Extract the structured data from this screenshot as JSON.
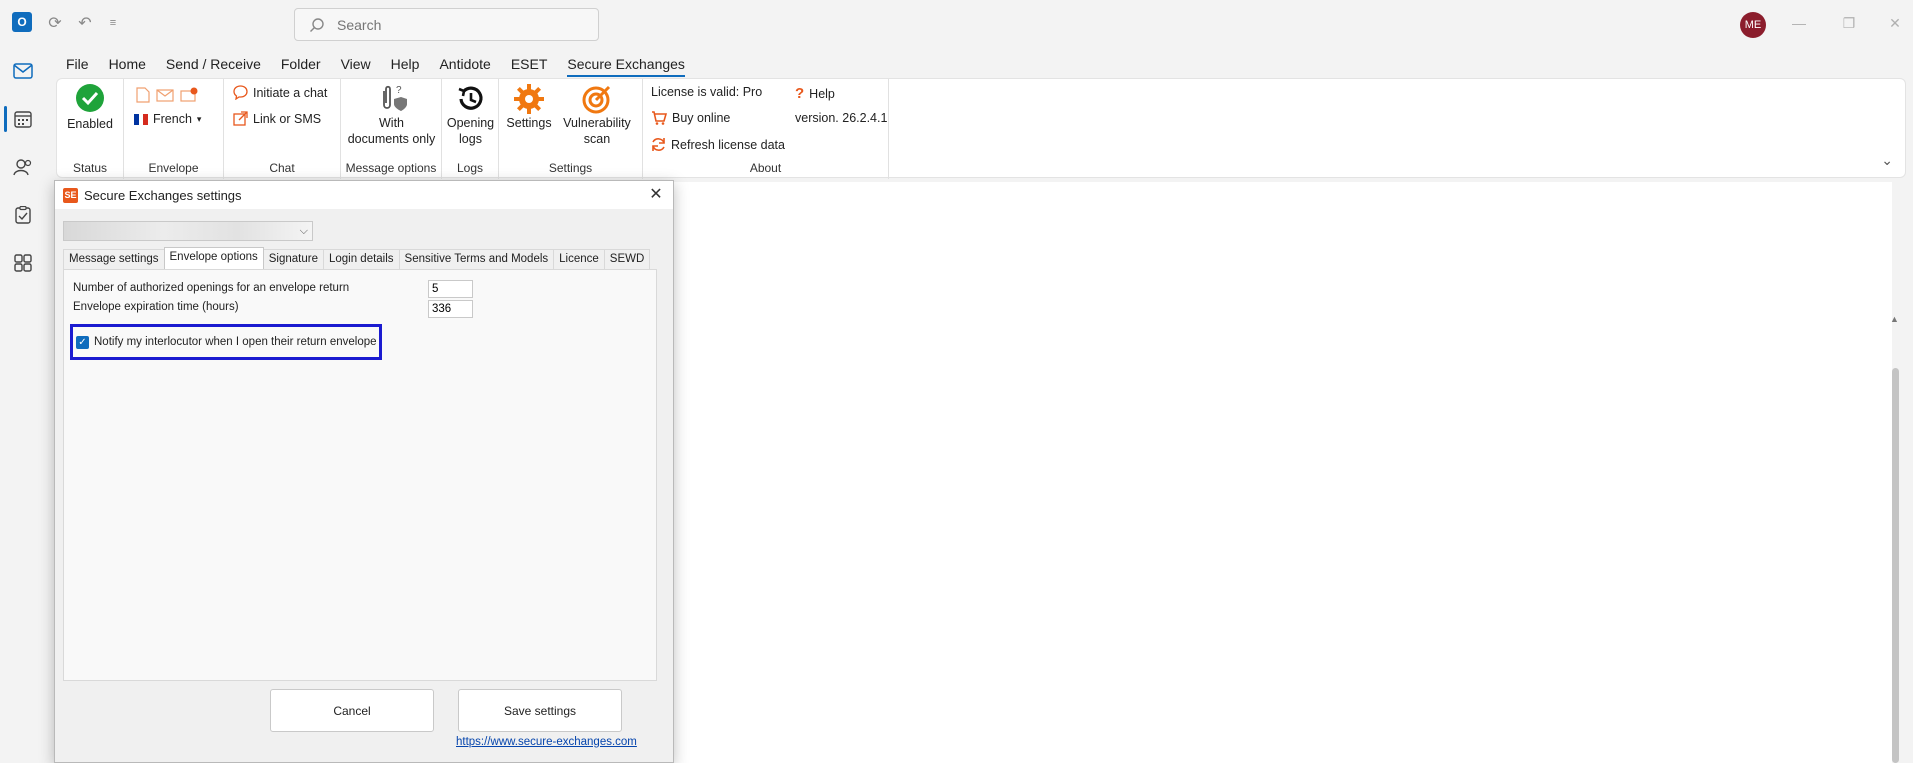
{
  "titlebar": {
    "search_placeholder": "Search",
    "avatar_initials": "ME"
  },
  "menu": {
    "tabs": [
      "File",
      "Home",
      "Send / Receive",
      "Folder",
      "View",
      "Help",
      "Antidote",
      "ESET",
      "Secure Exchanges"
    ],
    "active_tab": "Secure Exchanges"
  },
  "ribbon": {
    "status": {
      "label": "Status",
      "enabled": "Enabled"
    },
    "envelope": {
      "label": "Envelope",
      "language": "French"
    },
    "chat": {
      "label": "Chat",
      "initiate": "Initiate a chat",
      "link_sms": "Link or SMS"
    },
    "message_options": {
      "label": "Message options",
      "with_documents_1": "With",
      "with_documents_2": "documents only"
    },
    "logs": {
      "label": "Logs",
      "opening_1": "Opening",
      "opening_2": "logs"
    },
    "settings": {
      "label": "Settings",
      "settings_btn": "Settings",
      "vuln_1": "Vulnerability",
      "vuln_2": "scan"
    },
    "about": {
      "label": "About",
      "license": "License is valid: Pro",
      "buy": "Buy online",
      "refresh": "Refresh license data",
      "help": "Help",
      "version": "version. 26.2.4.1"
    }
  },
  "dialog": {
    "title": "Secure Exchanges settings",
    "tabs": [
      "Message settings",
      "Envelope options",
      "Signature",
      "Login details",
      "Sensitive Terms and Models",
      "Licence",
      "SEWD"
    ],
    "active_tab": "Envelope options",
    "fields": {
      "openings_label": "Number of authorized openings for an envelope return",
      "openings_value": "5",
      "expiration_label": "Envelope expiration time (hours)",
      "expiration_value": "336",
      "notify_label": "Notify my interlocutor when I open their return envelope"
    },
    "cancel": "Cancel",
    "save": "Save settings",
    "link": "https://www.secure-exchanges.com"
  },
  "colors": {
    "accent": "#0f6cbd",
    "highlight_box": "#1b1bd0",
    "brand_orange": "#e8581c"
  }
}
